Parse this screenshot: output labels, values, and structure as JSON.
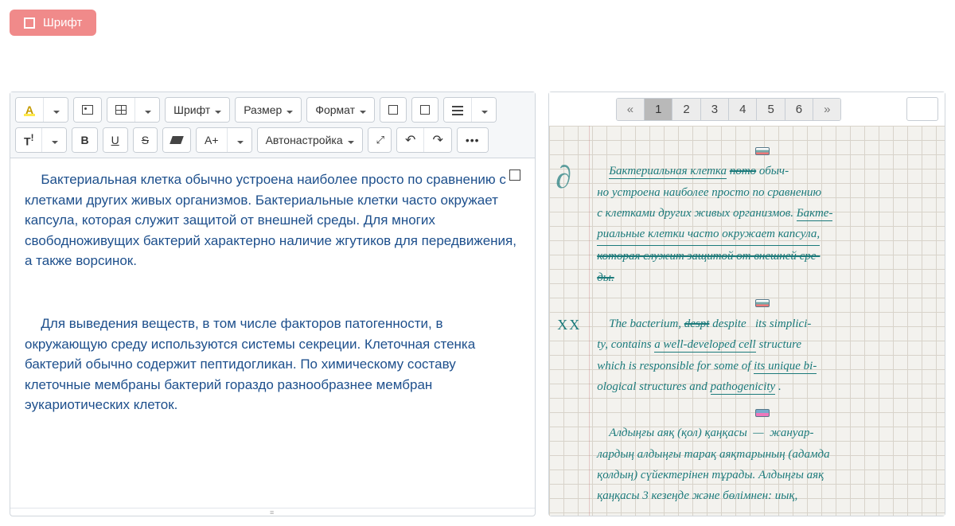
{
  "top_button": {
    "label": "Шрифт"
  },
  "toolbar": {
    "font_label": "Шрифт",
    "size_label": "Размер",
    "format_label": "Формат",
    "auto_label": "Автонастройка",
    "bold": "B",
    "underline": "U",
    "strike": "S",
    "fontsize_btn": "A",
    "text_format": "T",
    "a_plus": "A+"
  },
  "editor": {
    "para1": "Бактериальная клетка обычно устроена наиболее просто по сравнению с клетками других живых организмов. Бактериальные клетки часто окружает капсула, которая служит защитой от внешней среды. Для многих свободноживущих бактерий характерно наличие жгутиков для передвижения, а также ворсинок.",
    "para2": "Для выведения веществ, в том числе факторов патогенности, в окружающую среду используются системы секреции. Клеточная стенка бактерий обычно содержит пептидогликан. По химическому составу клеточные мембраны бактерий гораздо разнообразнее мембран эукариотических клеток."
  },
  "pager": {
    "prev": "«",
    "next": "»",
    "pages": [
      "1",
      "2",
      "3",
      "4",
      "5",
      "6"
    ],
    "active_index": 0,
    "input_value": ""
  },
  "handwriting": {
    "r1a": "Бактериальная клетка",
    "r1b_strike": "пото",
    "r1c": " обыч-",
    "r2": "но устроена наиболее просто по сравнению",
    "r3a": "с клетками других живых организмов. ",
    "r3b": "Бакте-",
    "r4": "риальные клетки часто окружает капсула,",
    "r5_strike": "которая служит защитой от внешней сре-",
    "r6_strike": "ды.",
    "e1a": "The bacterium, ",
    "e1b_strike": "despt",
    "e1c": " despite   its simplici-",
    "e2a": "ty, contains ",
    "e2b_ul": "a well-developed cell",
    "e2c": " structure",
    "e3a": "which is responsible for some of ",
    "e3b_ul": "its unique bi-",
    "e4a": "ological structures and ",
    "e4b_ul": "pathogenicity",
    "e4c": " .",
    "k1": "Алдыңғы аяқ (қол) қаңқасы  —  жануар-",
    "k2": "лардың алдыңғы тарақ аяқтарының (адамда",
    "k3": "қолдың) сүйектерінен тұрады. Алдыңғы аяқ",
    "k4": "қаңқасы 3 кезеңде және бөлімнен: иық,"
  }
}
